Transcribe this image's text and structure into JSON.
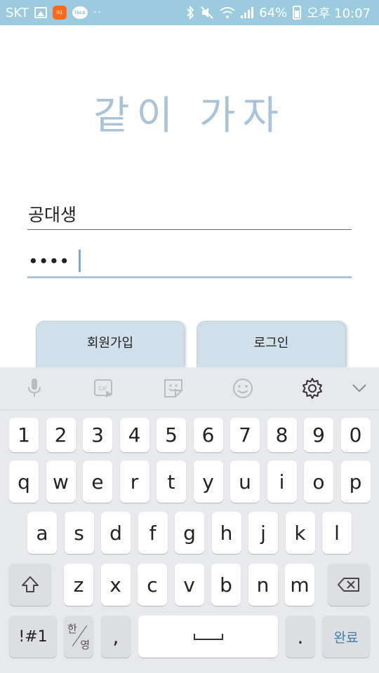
{
  "status_bar": {
    "carrier": "SKT",
    "battery_percent": "64%",
    "time": "오후 10:07",
    "app_badge_text": "01",
    "talk_badge_text": "TALK",
    "icons": [
      "gallery-icon",
      "app-notification-icon",
      "talk-icon",
      "bluetooth-icon",
      "mute-icon",
      "wifi-icon",
      "signal-icon",
      "battery-icon"
    ]
  },
  "app": {
    "title": "같이 가자",
    "username_value": "공대생",
    "password_value": "••••",
    "signup_label": "회원가입",
    "login_label": "로그인",
    "accent_color": "#a9c3d8",
    "button_color": "#cfe0ea"
  },
  "keyboard": {
    "toolbar_icons": [
      "microphone-icon",
      "gif-icon",
      "sticker-icon",
      "emoji-icon",
      "settings-icon",
      "chevron-down-icon"
    ],
    "row_numbers": [
      "1",
      "2",
      "3",
      "4",
      "5",
      "6",
      "7",
      "8",
      "9",
      "0"
    ],
    "row_top": [
      "q",
      "w",
      "e",
      "r",
      "t",
      "y",
      "u",
      "i",
      "o",
      "p"
    ],
    "row_middle": [
      "a",
      "s",
      "d",
      "f",
      "g",
      "h",
      "j",
      "k",
      "l"
    ],
    "row_bottom": [
      "z",
      "x",
      "c",
      "v",
      "b",
      "n",
      "m"
    ],
    "symbols_label": "!#1",
    "lang_han": "한",
    "lang_eng": "영",
    "comma": ",",
    "period": ".",
    "done_label": "완료",
    "done_color": "#3b7db5"
  }
}
